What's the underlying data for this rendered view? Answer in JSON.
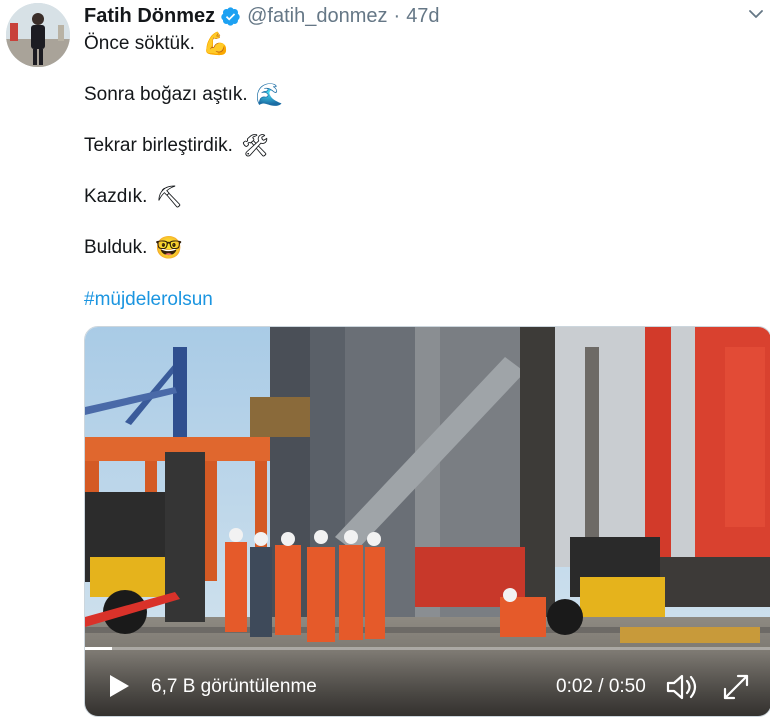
{
  "tweet": {
    "author_name": "Fatih Dönmez",
    "handle": "@fatih_donmez",
    "separator": "·",
    "time": "47d",
    "lines": {
      "l1": "Önce söktük.",
      "l2": "Sonra boğazı aştık.",
      "l3": "Tekrar birleştirdik.",
      "l4": "Kazdık.",
      "l5": "Bulduk.",
      "hashtag": "#müjdelerolsun"
    },
    "emojis": {
      "e1": "💪",
      "e2": "🌊",
      "e3": "🛠",
      "e4": "⛏",
      "e5": "🤓"
    }
  },
  "video": {
    "views": "6,7 B görüntülenme",
    "timer": "0:02 / 0:50",
    "progress_fraction": 0.04
  },
  "colors": {
    "hashtag": "#1b95e0",
    "verified": "#1da1f2",
    "muted": "#657786"
  }
}
